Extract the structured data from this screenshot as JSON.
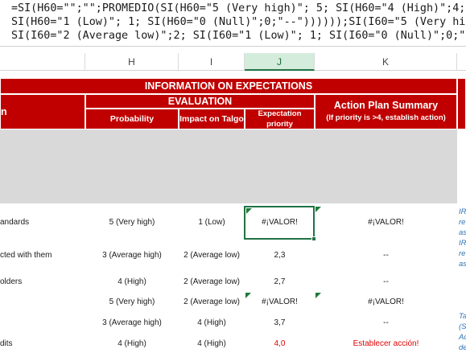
{
  "formula_bar": {
    "line1": "=SI(H60=\"\";\"\";PROMEDIO(SI(H60=\"5 (Very high)\"; 5; SI(H60=\"4 (High)\";4;",
    "line2": "SI(H60=\"1 (Low)\"; 1; SI(H60=\"0 (Null)\";0;\"--\"))))));SI(I60=\"5 (Very high",
    "line3": "SI(I60=\"2 (Average low)\";2; SI(I60=\"1 (Low)\"; 1; SI(I60=\"0 (Null)\";0;\""
  },
  "columns": [
    "H",
    "I",
    "J",
    "K"
  ],
  "active_column": "J",
  "header": {
    "title": "INFORMATION ON EXPECTATIONS",
    "left_fragment": "n",
    "evaluation": "EVALUATION",
    "probability": "Probability",
    "impact": "Impact on Talgo",
    "priority_line1": "Expectation",
    "priority_line2": "priority",
    "plan_title": "Action Plan Summary",
    "plan_note": "(If priority is >4, establish action)"
  },
  "rows": [
    {
      "left": "andards",
      "prob": "5 (Very  high)",
      "impact": "1 (Low)",
      "priority": "#¡VALOR!",
      "plan": "#¡VALOR!",
      "priority_red": false,
      "plan_red": false
    },
    {
      "left": "cted with them",
      "prob": "3 (Average high)",
      "impact": "2 (Average low)",
      "priority": "2,3",
      "plan": "--",
      "priority_red": false,
      "plan_red": false
    },
    {
      "left": "olders",
      "prob": "4 (High)",
      "impact": "2 (Average low)",
      "priority": "2,7",
      "plan": "--",
      "priority_red": false,
      "plan_red": false
    },
    {
      "left": "",
      "prob": "5 (Very  high)",
      "impact": "2 (Average low)",
      "priority": "#¡VALOR!",
      "plan": "#¡VALOR!",
      "priority_red": false,
      "plan_red": false
    },
    {
      "left": "",
      "prob": "3 (Average high)",
      "impact": "4 (High)",
      "priority": "3,7",
      "plan": "--",
      "priority_red": false,
      "plan_red": false
    },
    {
      "left": "dits",
      "prob": "4 (High)",
      "impact": "4 (High)",
      "priority": "4,0",
      "plan": "Establecer acción!",
      "priority_red": true,
      "plan_red": true
    }
  ],
  "side_text": [
    "IR",
    "re",
    "as",
    "IR",
    "re",
    "as",
    "Ta",
    "(St",
    "Ac",
    "de"
  ],
  "colors": {
    "header_red": "#c00000",
    "excel_green": "#217346",
    "error_red": "#e00000",
    "link_blue": "#2e74b5"
  }
}
